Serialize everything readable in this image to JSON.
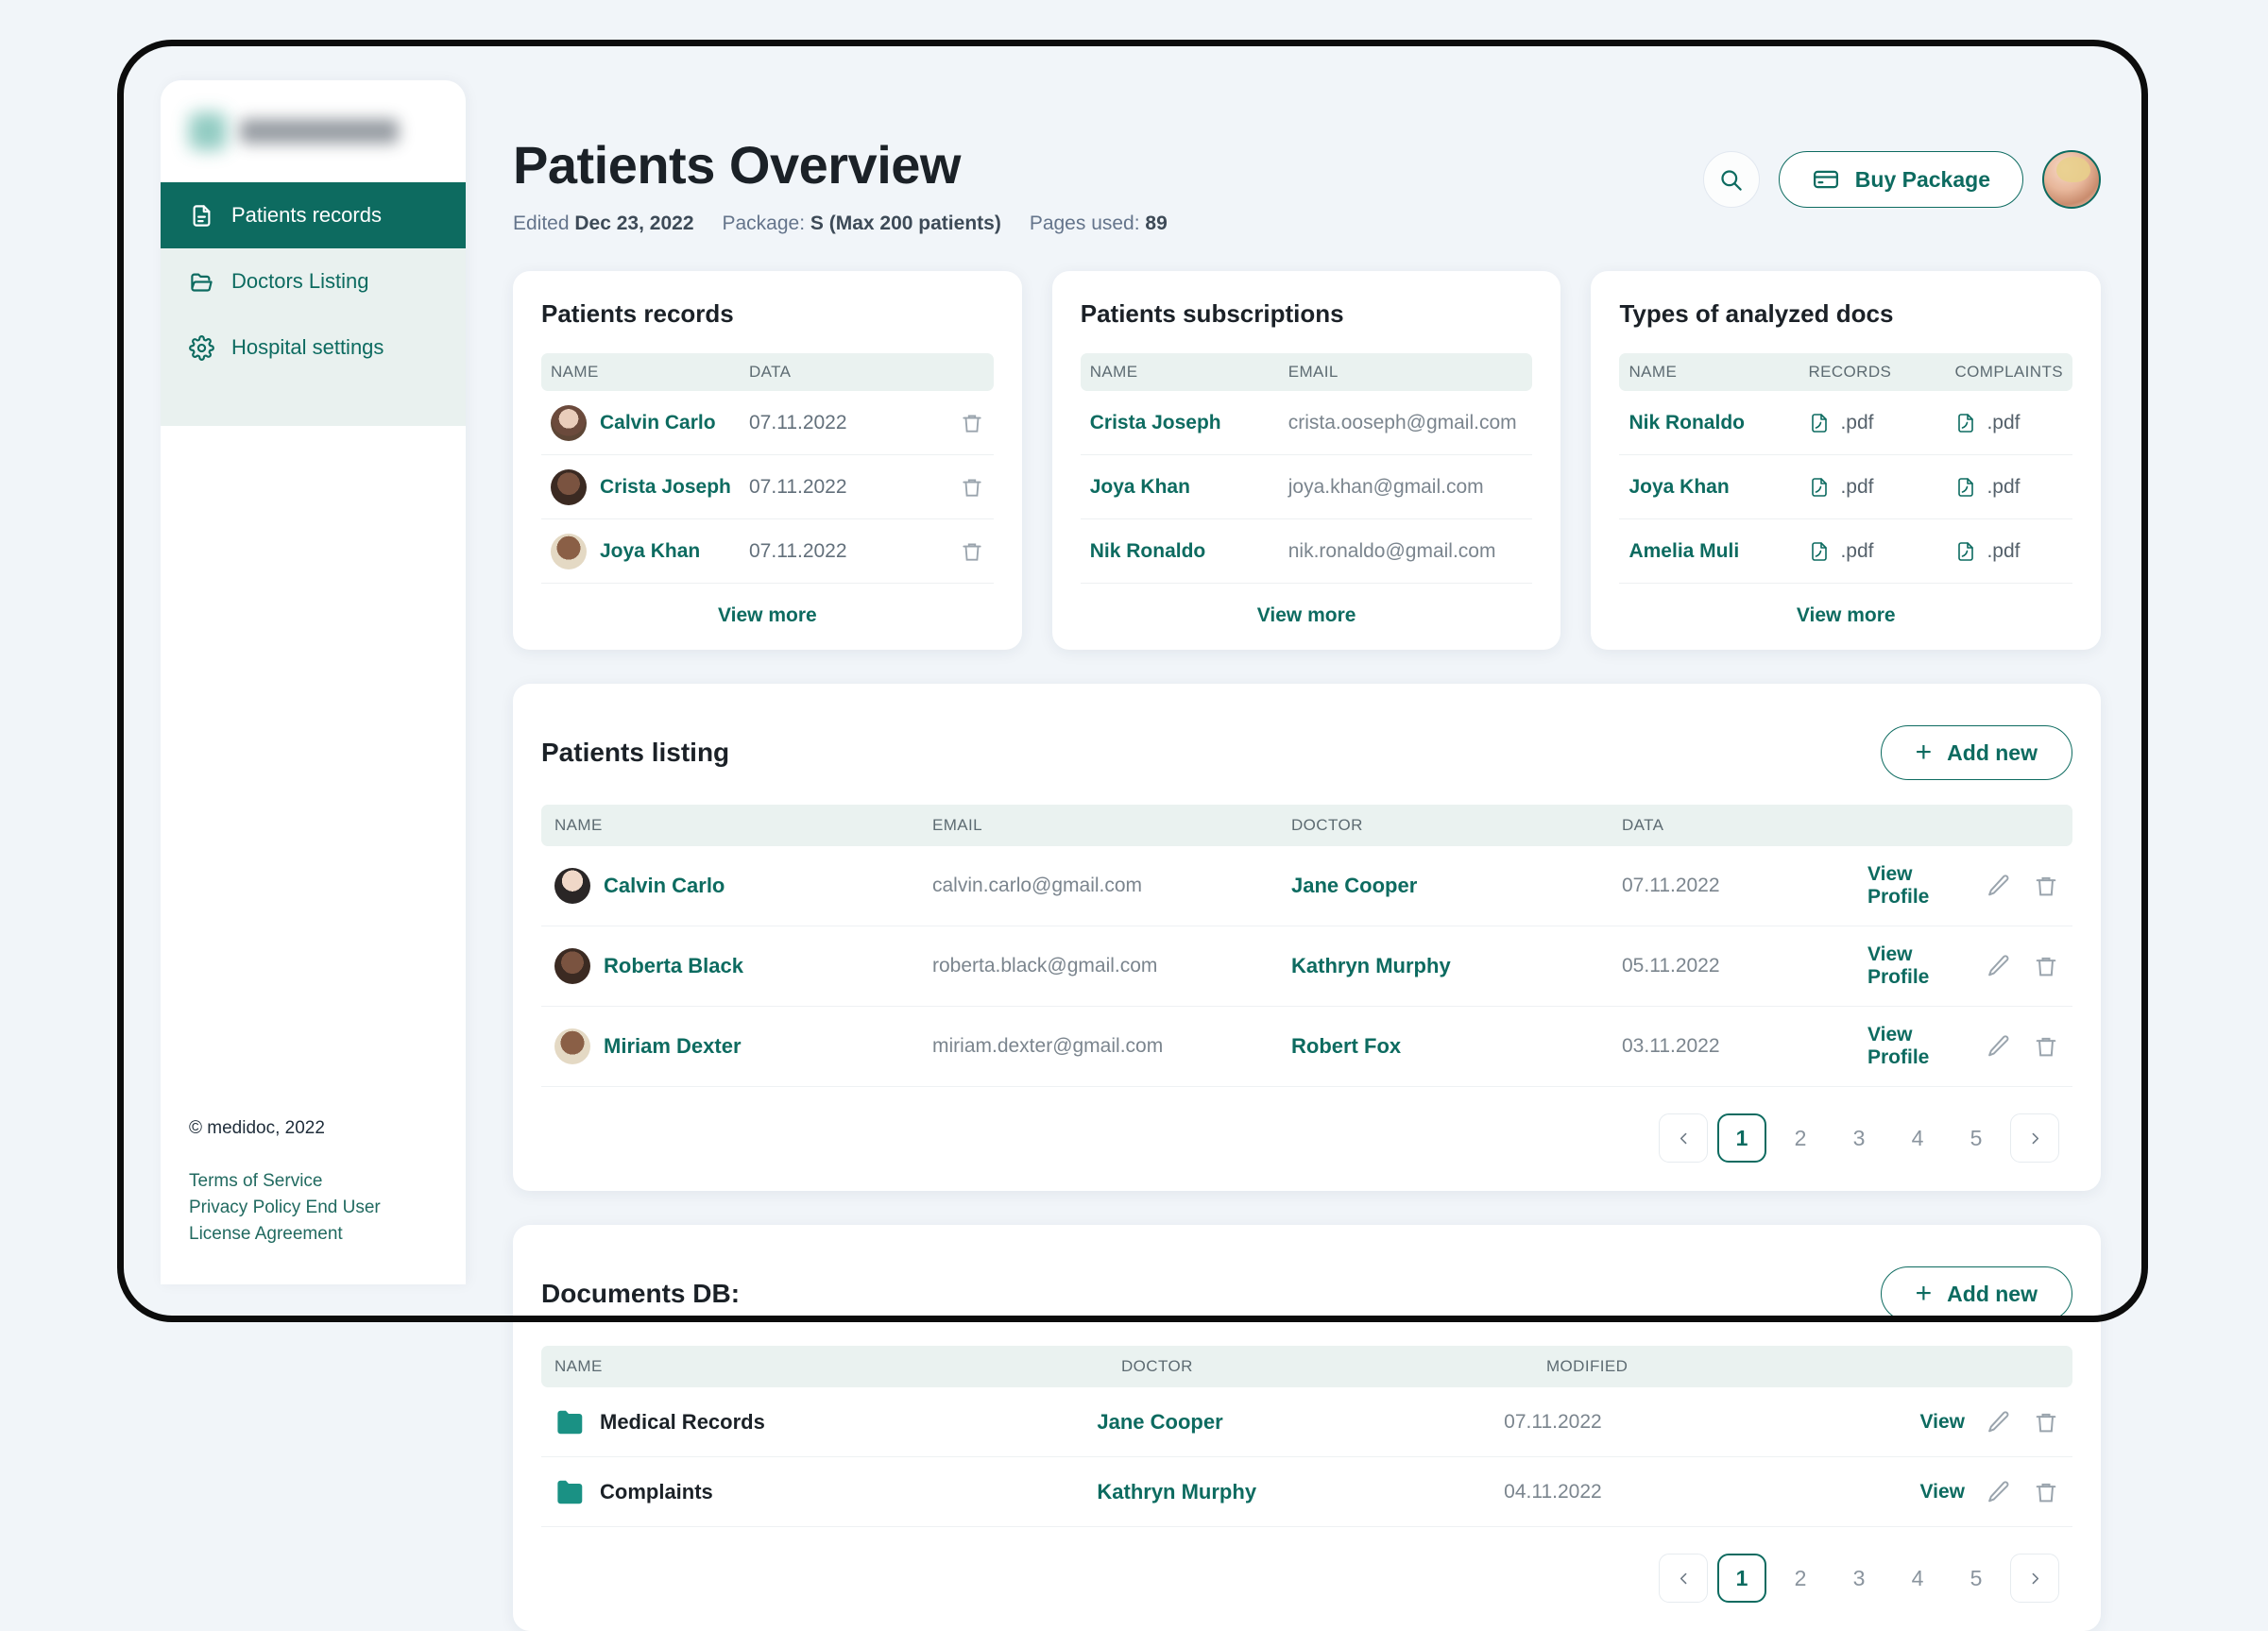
{
  "sidebar": {
    "logo_alt": "medidoc-logo-blurred",
    "items": [
      {
        "label": "Patients records",
        "icon": "document-icon",
        "active": true
      },
      {
        "label": "Doctors Listing",
        "icon": "folder-open-icon",
        "active": false
      },
      {
        "label": "Hospital settings",
        "icon": "gear-icon",
        "active": false
      }
    ],
    "copyright": "© medidoc, 2022",
    "links": [
      "Terms of Service",
      "Privacy Policy End User",
      "License Agreement"
    ]
  },
  "header": {
    "title": "Patients Overview",
    "edited_label": "Edited",
    "edited_value": "Dec 23, 2022",
    "package_label": "Package:",
    "package_value": "S (Max 200 patients)",
    "pages_label": "Pages used:",
    "pages_value": "89",
    "search_icon": "search-icon",
    "buy_button": "Buy Package",
    "card_icon": "credit-card-icon",
    "avatar": "user-avatar"
  },
  "cards": [
    {
      "title": "Patients records",
      "columns": [
        "NAME",
        "DATA"
      ],
      "rows": [
        {
          "name": "Calvin Carlo",
          "data": "07.11.2022"
        },
        {
          "name": "Crista Joseph",
          "data": "07.11.2022"
        },
        {
          "name": "Joya Khan",
          "data": "07.11.2022"
        }
      ],
      "view_more": "View more"
    },
    {
      "title": "Patients subscriptions",
      "columns": [
        "NAME",
        "EMAIL"
      ],
      "rows": [
        {
          "name": "Crista Joseph",
          "email": "crista.ooseph@gmail.com"
        },
        {
          "name": "Joya Khan",
          "email": "joya.khan@gmail.com"
        },
        {
          "name": "Nik Ronaldo",
          "email": "nik.ronaldo@gmail.com"
        }
      ],
      "view_more": "View more"
    },
    {
      "title": "Types of analyzed docs",
      "columns": [
        "NAME",
        "RECORDS",
        "COMPLAINTS"
      ],
      "rows": [
        {
          "name": "Nik Ronaldo",
          "records": ".pdf",
          "complaints": ".pdf"
        },
        {
          "name": "Joya Khan",
          "records": ".pdf",
          "complaints": ".pdf"
        },
        {
          "name": "Amelia Muli",
          "records": ".pdf",
          "complaints": ".pdf"
        }
      ],
      "view_more": "View more"
    }
  ],
  "patients_listing": {
    "title": "Patients listing",
    "add_button": "Add new",
    "columns": [
      "NAME",
      "EMAIL",
      "DOCTOR",
      "DATA"
    ],
    "rows": [
      {
        "name": "Calvin Carlo",
        "email": "calvin.carlo@gmail.com",
        "doctor": "Jane Cooper",
        "date": "07.11.2022",
        "action": "View Profile"
      },
      {
        "name": "Roberta Black",
        "email": "roberta.black@gmail.com",
        "doctor": "Kathryn Murphy",
        "date": "05.11.2022",
        "action": "View Profile"
      },
      {
        "name": "Miriam Dexter",
        "email": "miriam.dexter@gmail.com",
        "doctor": "Robert Fox",
        "date": "03.11.2022",
        "action": "View Profile"
      }
    ],
    "pagination": {
      "prev": "‹",
      "pages": [
        "1",
        "2",
        "3",
        "4",
        "5"
      ],
      "active": "1",
      "next": "›"
    }
  },
  "documents_db": {
    "title": "Documents DB:",
    "add_button": "Add new",
    "columns": [
      "NAME",
      "DOCTOR",
      "MODIFIED"
    ],
    "rows": [
      {
        "name": "Medical Records",
        "doctor": "Jane Cooper",
        "modified": "07.11.2022",
        "action": "View"
      },
      {
        "name": "Complaints",
        "doctor": "Kathryn Murphy",
        "modified": "04.11.2022",
        "action": "View"
      }
    ],
    "pagination": {
      "prev": "‹",
      "pages": [
        "1",
        "2",
        "3",
        "4",
        "5"
      ],
      "active": "1",
      "next": "›"
    }
  },
  "colors": {
    "brand_teal": "#0d6b60",
    "page_bg": "#f1f5f9",
    "header_row_bg": "#eaf2f0"
  }
}
